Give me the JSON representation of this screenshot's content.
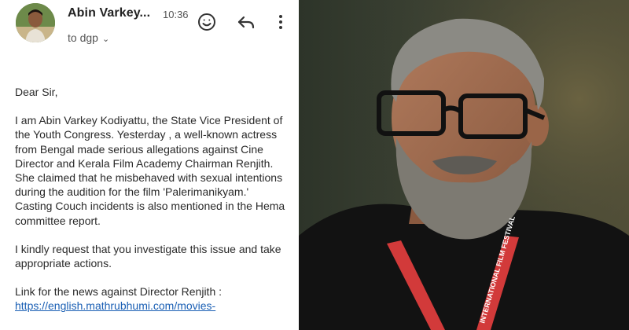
{
  "email": {
    "sender_name": "Abin Varkey...",
    "time": "10:36",
    "recipient": "to dgp",
    "icons": {
      "avatar": "avatar",
      "emoji": "emoji-icon",
      "reply": "reply-icon",
      "more": "more-vert-icon",
      "chevron": "chevron-down-icon"
    },
    "greeting": "Dear Sir,",
    "paragraph1": "I am Abin Varkey Kodiyattu, the State Vice President of the Youth Congress. Yesterday , a well-known actress from Bengal made serious allegations against Cine Director and Kerala Film Academy Chairman Renjith. She claimed that he misbehaved with sexual intentions during the audition for the film 'Palerimanikyam.' Casting Couch incidents is also mentioned in the Hema committee report.",
    "paragraph2": "I kindly request that you investigate this issue and take appropriate actions.",
    "link_label": "Link for the news against Director Renjith :",
    "link_url": "https://english.mathrubhumi.com/movies-"
  },
  "photo": {
    "lanyard_text": "INTERNATIONAL FILM FESTIVAL",
    "colors": {
      "background": "#3a4032",
      "shirt": "#111111",
      "lanyard": "#d23a3a"
    }
  }
}
